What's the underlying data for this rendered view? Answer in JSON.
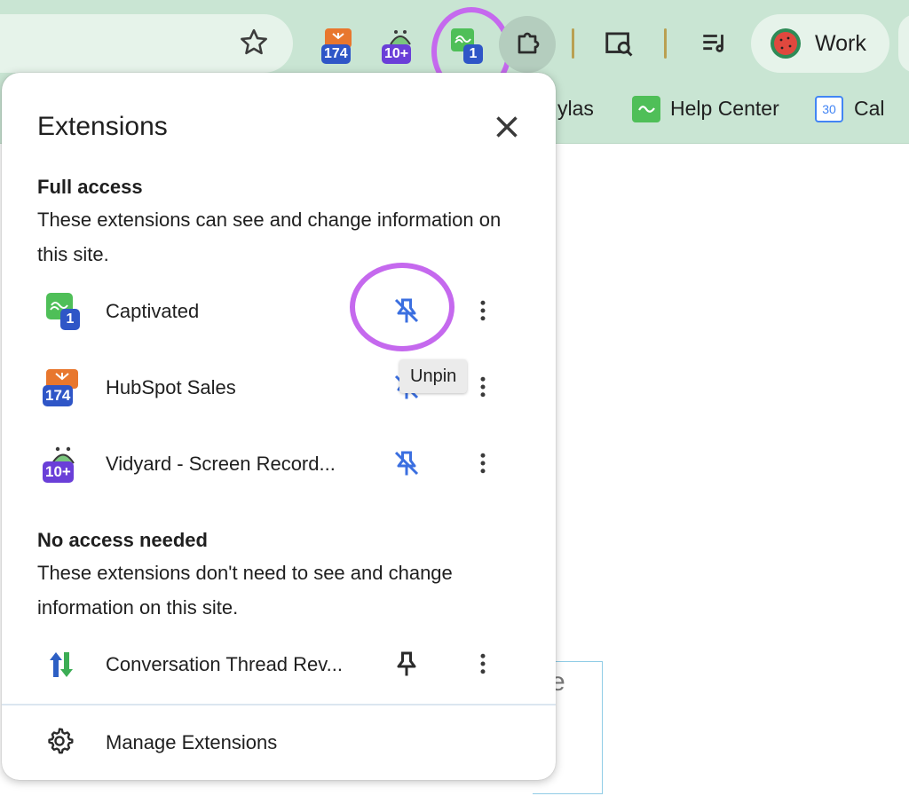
{
  "toolbar": {
    "extension_badges": [
      "174",
      "10+",
      "1"
    ],
    "profile_label": "Work"
  },
  "bookmarks": {
    "items": [
      {
        "label": "ylas"
      },
      {
        "label": "Help Center"
      },
      {
        "label": "Cal",
        "icon_text": "30"
      }
    ]
  },
  "popup": {
    "title": "Extensions",
    "full_access": {
      "title": "Full access",
      "description": "These extensions can see and change information on this site.",
      "items": [
        {
          "name": "Captivated",
          "badge": "1",
          "pinned": true
        },
        {
          "name": "HubSpot Sales",
          "badge": "174",
          "pinned": true
        },
        {
          "name": "Vidyard - Screen Record...",
          "badge": "10+",
          "pinned": true
        }
      ]
    },
    "no_access": {
      "title": "No access needed",
      "description": "These extensions don't need to see and change information on this site.",
      "items": [
        {
          "name": "Conversation Thread Rev...",
          "pinned": false
        }
      ]
    },
    "tooltip": "Unpin",
    "manage_label": "Manage Extensions"
  },
  "page": {
    "partial_text": "e"
  },
  "colors": {
    "chrome_bg": "#c9e5d3",
    "highlight": "#c569ee",
    "badge": "#2f56c7",
    "pin_active": "#3b6fe0",
    "hubspot_orange": "#e8772e",
    "vidyard_purple": "#6a3fd8",
    "captivated_green": "#4fbf58"
  }
}
